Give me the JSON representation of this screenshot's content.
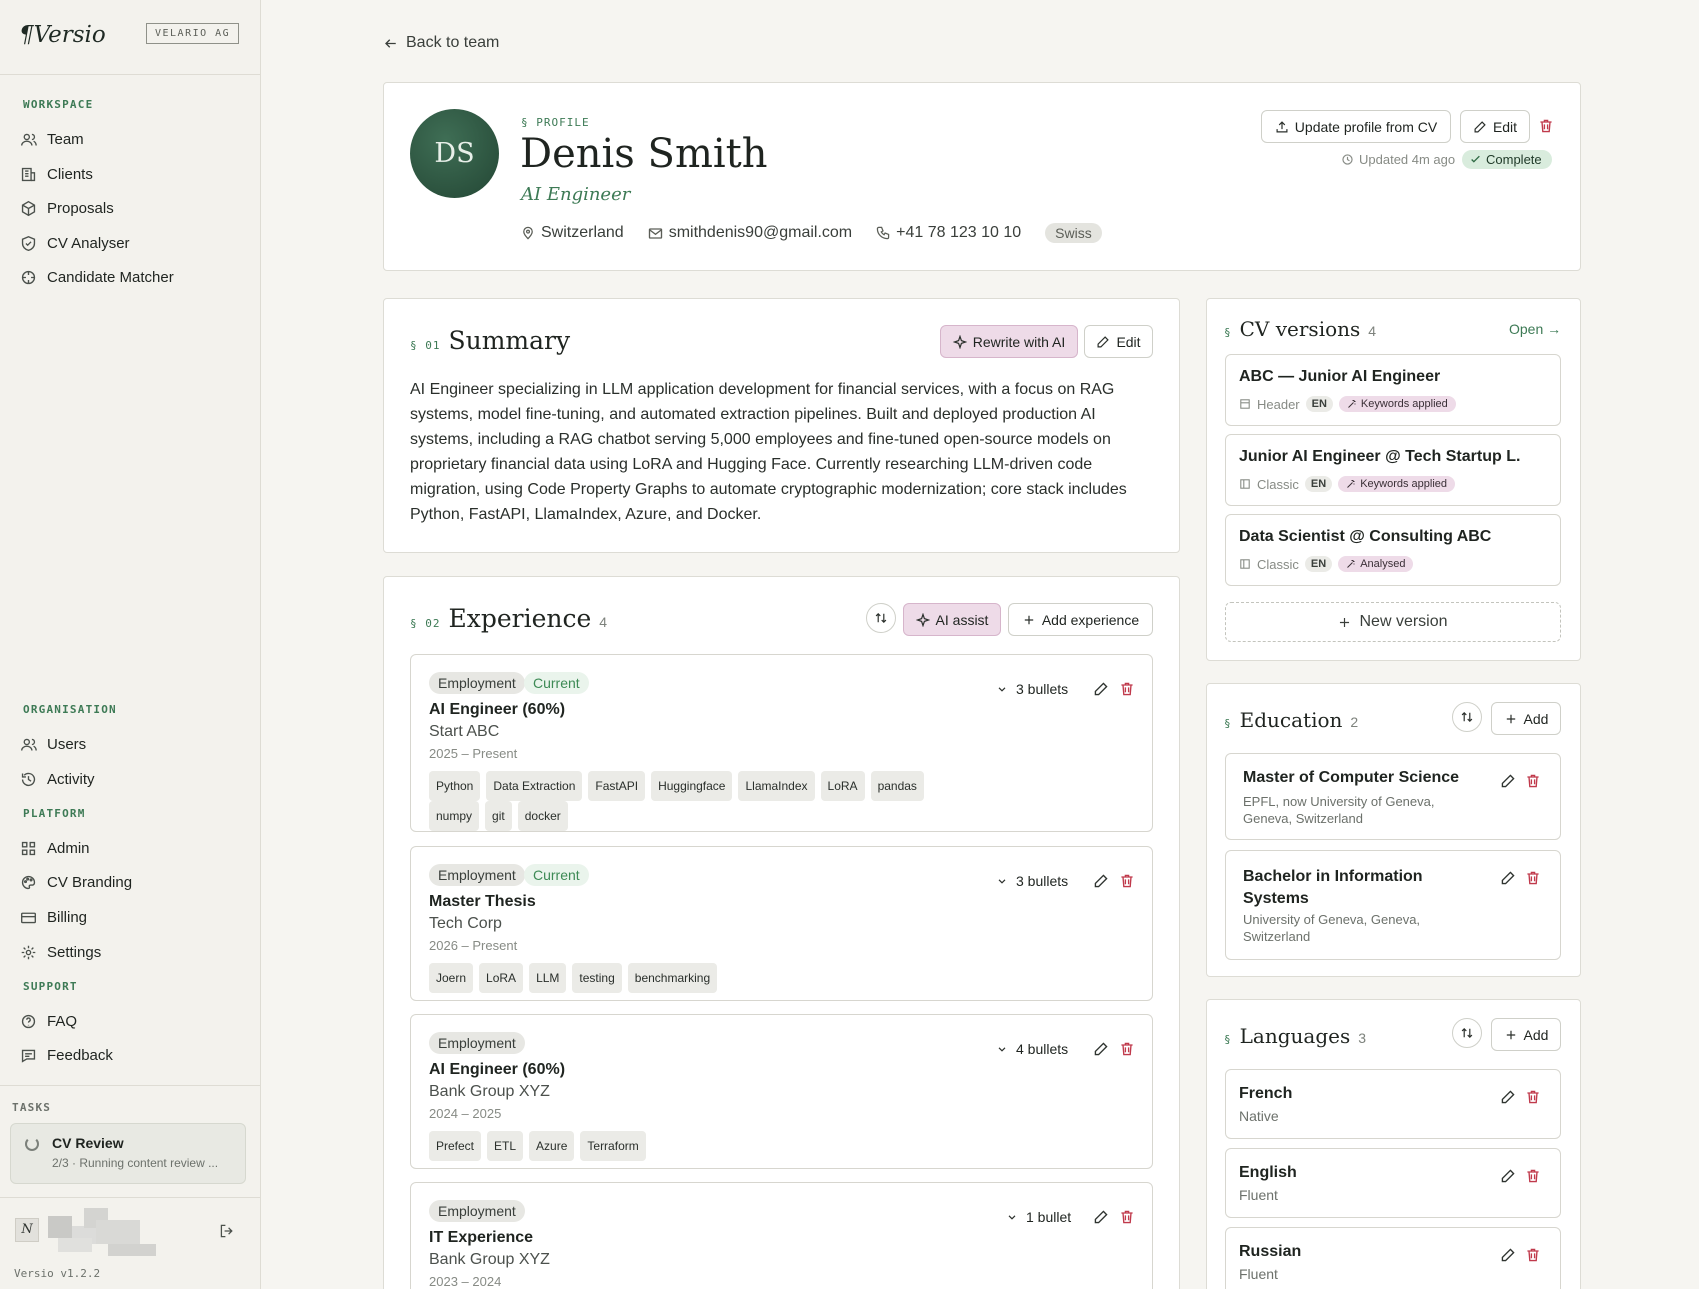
{
  "sidebar": {
    "logo": "¶Versio",
    "org": "VELARIO AG",
    "sections": {
      "workspace": "WORKSPACE",
      "organisation": "ORGANISATION",
      "platform": "PLATFORM",
      "support": "SUPPORT",
      "tasks": "TASKS"
    },
    "workspace_items": [
      {
        "label": "Team",
        "icon": "users-icon"
      },
      {
        "label": "Clients",
        "icon": "building-icon"
      },
      {
        "label": "Proposals",
        "icon": "package-icon"
      },
      {
        "label": "CV Analyser",
        "icon": "shield-check-icon"
      },
      {
        "label": "Candidate Matcher",
        "icon": "target-icon"
      }
    ],
    "organisation_items": [
      {
        "label": "Users",
        "icon": "users-icon"
      },
      {
        "label": "Activity",
        "icon": "history-icon"
      }
    ],
    "platform_items": [
      {
        "label": "Admin",
        "icon": "grid-icon"
      },
      {
        "label": "CV Branding",
        "icon": "palette-icon"
      },
      {
        "label": "Billing",
        "icon": "card-icon"
      },
      {
        "label": "Settings",
        "icon": "gear-icon"
      }
    ],
    "support_items": [
      {
        "label": "FAQ",
        "icon": "help-icon"
      },
      {
        "label": "Feedback",
        "icon": "message-icon"
      }
    ],
    "task": {
      "title": "CV Review",
      "subtitle": "2/3 · Running content review ..."
    },
    "user_initial": "N",
    "version": "Versio v1.2.2"
  },
  "back_label": "Back to team",
  "profile": {
    "section_label": "§ PROFILE",
    "initials": "DS",
    "name": "Denis Smith",
    "role": "AI Engineer",
    "location": "Switzerland",
    "email": "smithdenis90@gmail.com",
    "phone": "+41 78 123 10 10",
    "nationality": "Swiss",
    "update_btn": "Update profile from CV",
    "edit_btn": "Edit",
    "updated": "Updated 4m ago",
    "status": "Complete"
  },
  "summary": {
    "num": "§ 01",
    "title": "Summary",
    "rewrite_btn": "Rewrite with AI",
    "edit_btn": "Edit",
    "text": "AI Engineer specializing in LLM application development for financial services, with a focus on RAG systems, model fine-tuning, and automated extraction pipelines. Built and deployed production AI systems, including a RAG chatbot serving 5,000 employees and fine-tuned open-source models on proprietary financial data using LoRA and Hugging Face. Currently researching LLM-driven code migration, using Code Property Graphs to automate cryptographic modernization; core stack includes Python, FastAPI, LlamaIndex, Azure, and Docker."
  },
  "experience": {
    "num": "§ 02",
    "title": "Experience",
    "count": "4",
    "ai_btn": "AI assist",
    "add_btn": "Add experience",
    "entries": [
      {
        "type": "Employment",
        "current": "Current",
        "title": "AI Engineer (60%)",
        "company": "Start ABC",
        "dates": "2025 – Present",
        "bullets": "3 bullets",
        "tags": [
          "Python",
          "Data Extraction",
          "FastAPI",
          "Huggingface",
          "LlamaIndex",
          "LoRA",
          "pandas",
          "numpy",
          "git",
          "docker"
        ]
      },
      {
        "type": "Employment",
        "current": "Current",
        "title": "Master Thesis",
        "company": "Tech Corp",
        "dates": "2026 – Present",
        "bullets": "3 bullets",
        "tags": [
          "Joern",
          "LoRA",
          "LLM",
          "testing",
          "benchmarking"
        ]
      },
      {
        "type": "Employment",
        "current": "",
        "title": "AI Engineer (60%)",
        "company": "Bank Group XYZ",
        "dates": "2024 – 2025",
        "bullets": "4 bullets",
        "tags": [
          "Prefect",
          "ETL",
          "Azure",
          "Terraform"
        ]
      },
      {
        "type": "Employment",
        "current": "",
        "title": "IT Experience",
        "company": "Bank Group XYZ",
        "dates": "2023 – 2024",
        "bullets": "1 bullet",
        "tags": []
      }
    ]
  },
  "cv_versions": {
    "num": "§",
    "title": "CV versions",
    "count": "4",
    "open_label": "Open →",
    "items": [
      {
        "title": "ABC — Junior AI Engineer",
        "template": "Header",
        "lang": "EN",
        "status": "Keywords applied"
      },
      {
        "title": "Junior AI Engineer @ Tech Startup L.",
        "template": "Classic",
        "lang": "EN",
        "status": "Keywords applied"
      },
      {
        "title": "Data Scientist @ Consulting ABC",
        "template": "Classic",
        "lang": "EN",
        "status": "Analysed"
      }
    ],
    "new_label": "New version"
  },
  "education": {
    "num": "§",
    "title": "Education",
    "count": "2",
    "add_btn": "Add",
    "items": [
      {
        "title": "Master of Computer Science",
        "sub": "EPFL, now University of Geneva, Geneva, Switzerland"
      },
      {
        "title": "Bachelor in Information Systems",
        "sub": "University of Geneva, Geneva, Switzerland"
      }
    ]
  },
  "languages": {
    "num": "§",
    "title": "Languages",
    "count": "3",
    "add_btn": "Add",
    "items": [
      {
        "title": "French",
        "sub": "Native"
      },
      {
        "title": "English",
        "sub": "Fluent"
      },
      {
        "title": "Russian",
        "sub": "Fluent"
      }
    ]
  },
  "colors": {
    "accent_green": "#3d7a55",
    "ai_pink": "#eedbe8",
    "danger": "#c0394b",
    "avatar": "#2f5a44"
  }
}
